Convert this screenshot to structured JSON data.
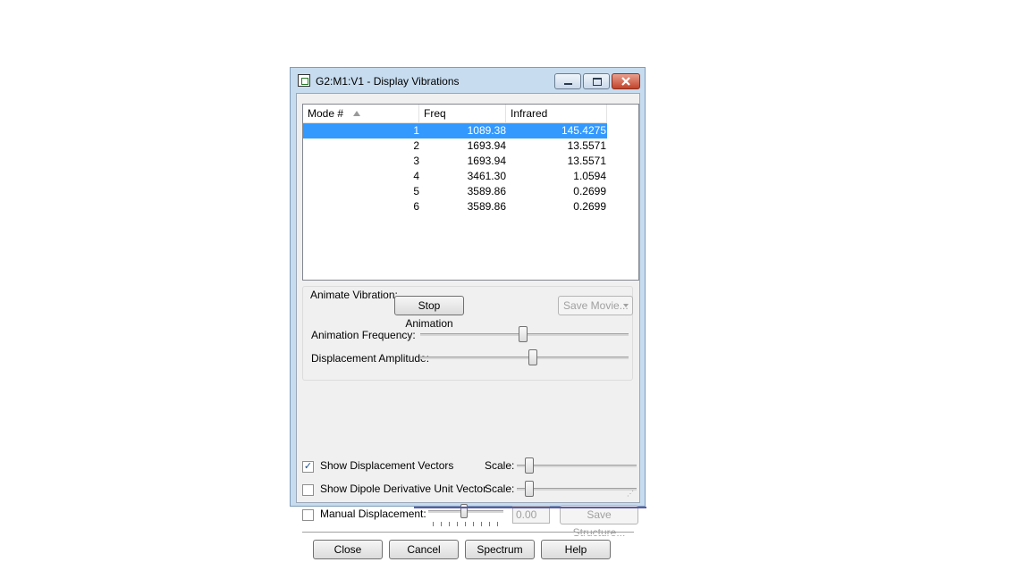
{
  "window": {
    "title": "G2:M1:V1 - Display Vibrations"
  },
  "list": {
    "columns": [
      "Mode #",
      "Freq",
      "Infrared"
    ],
    "rows": [
      {
        "mode": "1",
        "freq": "1089.38",
        "ir": "145.4275",
        "selected": true
      },
      {
        "mode": "2",
        "freq": "1693.94",
        "ir": "13.5571"
      },
      {
        "mode": "3",
        "freq": "1693.94",
        "ir": "13.5571"
      },
      {
        "mode": "4",
        "freq": "3461.30",
        "ir": "1.0594"
      },
      {
        "mode": "5",
        "freq": "3589.86",
        "ir": "0.2699"
      },
      {
        "mode": "6",
        "freq": "3589.86",
        "ir": "0.2699"
      }
    ]
  },
  "animate": {
    "group_label": "Animate Vibration:",
    "stop_button": "Stop Animation",
    "save_movie": "Save Movie...",
    "freq_label": "Animation Frequency:",
    "amp_label": "Displacement Amplitude:"
  },
  "options": {
    "show_vectors": "Show Displacement Vectors",
    "show_vectors_checked": true,
    "show_dipole": "Show Dipole Derivative Unit Vector",
    "show_dipole_checked": false,
    "scale_label": "Scale:",
    "manual_disp": "Manual Displacement:",
    "manual_disp_checked": false,
    "manual_value": "0.00",
    "save_structure": "Save Structure..."
  },
  "buttons": {
    "close": "Close",
    "cancel": "Cancel",
    "spectrum": "Spectrum",
    "help": "Help"
  },
  "colors": {
    "selection": "#3399ff",
    "titlebar": "#c7dcef",
    "close_button": "#c2432a"
  }
}
